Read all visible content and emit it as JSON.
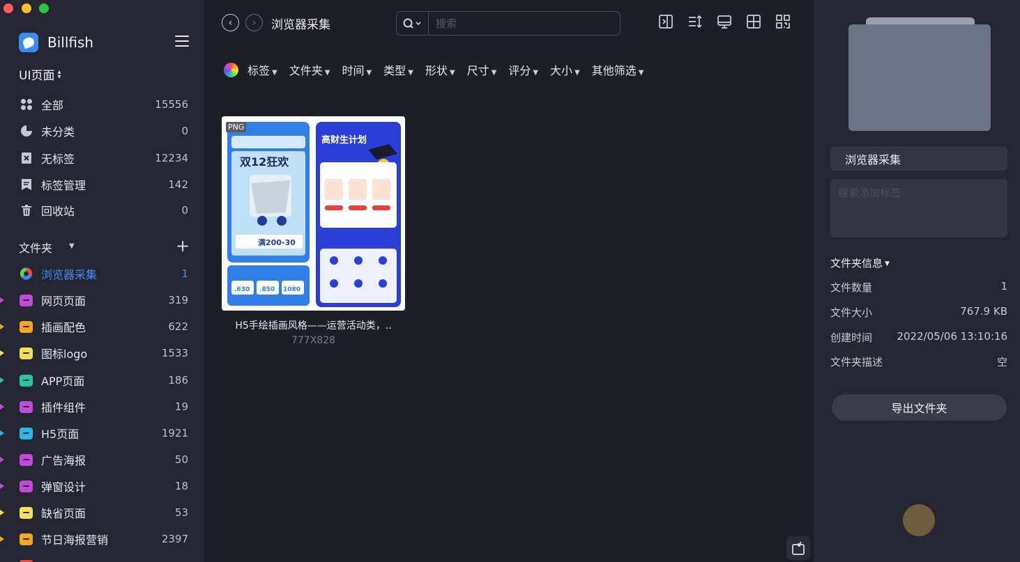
{
  "app": {
    "name": "Billfish",
    "library": "UI页面"
  },
  "sidebar": {
    "nav": [
      {
        "label": "全部",
        "count": "15556",
        "icon": "grid-icon"
      },
      {
        "label": "未分类",
        "count": "0",
        "icon": "pie-icon"
      },
      {
        "label": "无标签",
        "count": "12234",
        "icon": "no-tag-icon"
      },
      {
        "label": "标签管理",
        "count": "142",
        "icon": "tag-manage-icon"
      },
      {
        "label": "回收站",
        "count": "0",
        "icon": "trash-icon"
      }
    ],
    "folders_header": "文件夹",
    "folders": [
      {
        "label": "浏览器采集",
        "count": "1",
        "color": "#3f8cf5",
        "active": true
      },
      {
        "label": "网页页面",
        "count": "319",
        "color": "#c04bd9"
      },
      {
        "label": "插画配色",
        "count": "622",
        "color": "#f5a623"
      },
      {
        "label": "图标logo",
        "count": "1533",
        "color": "#f3e05a"
      },
      {
        "label": "APP页面",
        "count": "186",
        "color": "#25c6a5"
      },
      {
        "label": "插件组件",
        "count": "19",
        "color": "#c04bd9"
      },
      {
        "label": "H5页面",
        "count": "1921",
        "color": "#2bb6e6"
      },
      {
        "label": "广告海报",
        "count": "50",
        "color": "#c04bd9"
      },
      {
        "label": "弹窗设计",
        "count": "18",
        "color": "#c04bd9"
      },
      {
        "label": "缺省页面",
        "count": "53",
        "color": "#f3e05a"
      },
      {
        "label": "节日海报营销",
        "count": "2397",
        "color": "#f5a623"
      }
    ]
  },
  "main": {
    "title": "浏览器采集",
    "search_placeholder": "搜索",
    "filters": [
      "标签",
      "文件夹",
      "时间",
      "类型",
      "形状",
      "尺寸",
      "评分",
      "大小",
      "其他筛选"
    ],
    "card": {
      "badge": "PNG",
      "name": "H5手绘插画风格——运营活动类，..",
      "dims": "777X828",
      "thumb_left": {
        "title": "双12狂欢",
        "subtitle": "满200-30",
        "nums": [
          ".630",
          ".850",
          "1080"
        ]
      },
      "thumb_right": {
        "title": "高财生计划"
      }
    }
  },
  "panel": {
    "folder_name": "浏览器采集",
    "tag_placeholder": "搜索添加标签",
    "info_title": "文件夹信息",
    "info": [
      {
        "k": "文件数量",
        "v": "1"
      },
      {
        "k": "文件大小",
        "v": "767.9 KB"
      },
      {
        "k": "创建时间",
        "v": "2022/05/06 13:10:16"
      },
      {
        "k": "文件夹描述",
        "v": "空"
      }
    ],
    "export_label": "导出文件夹"
  }
}
